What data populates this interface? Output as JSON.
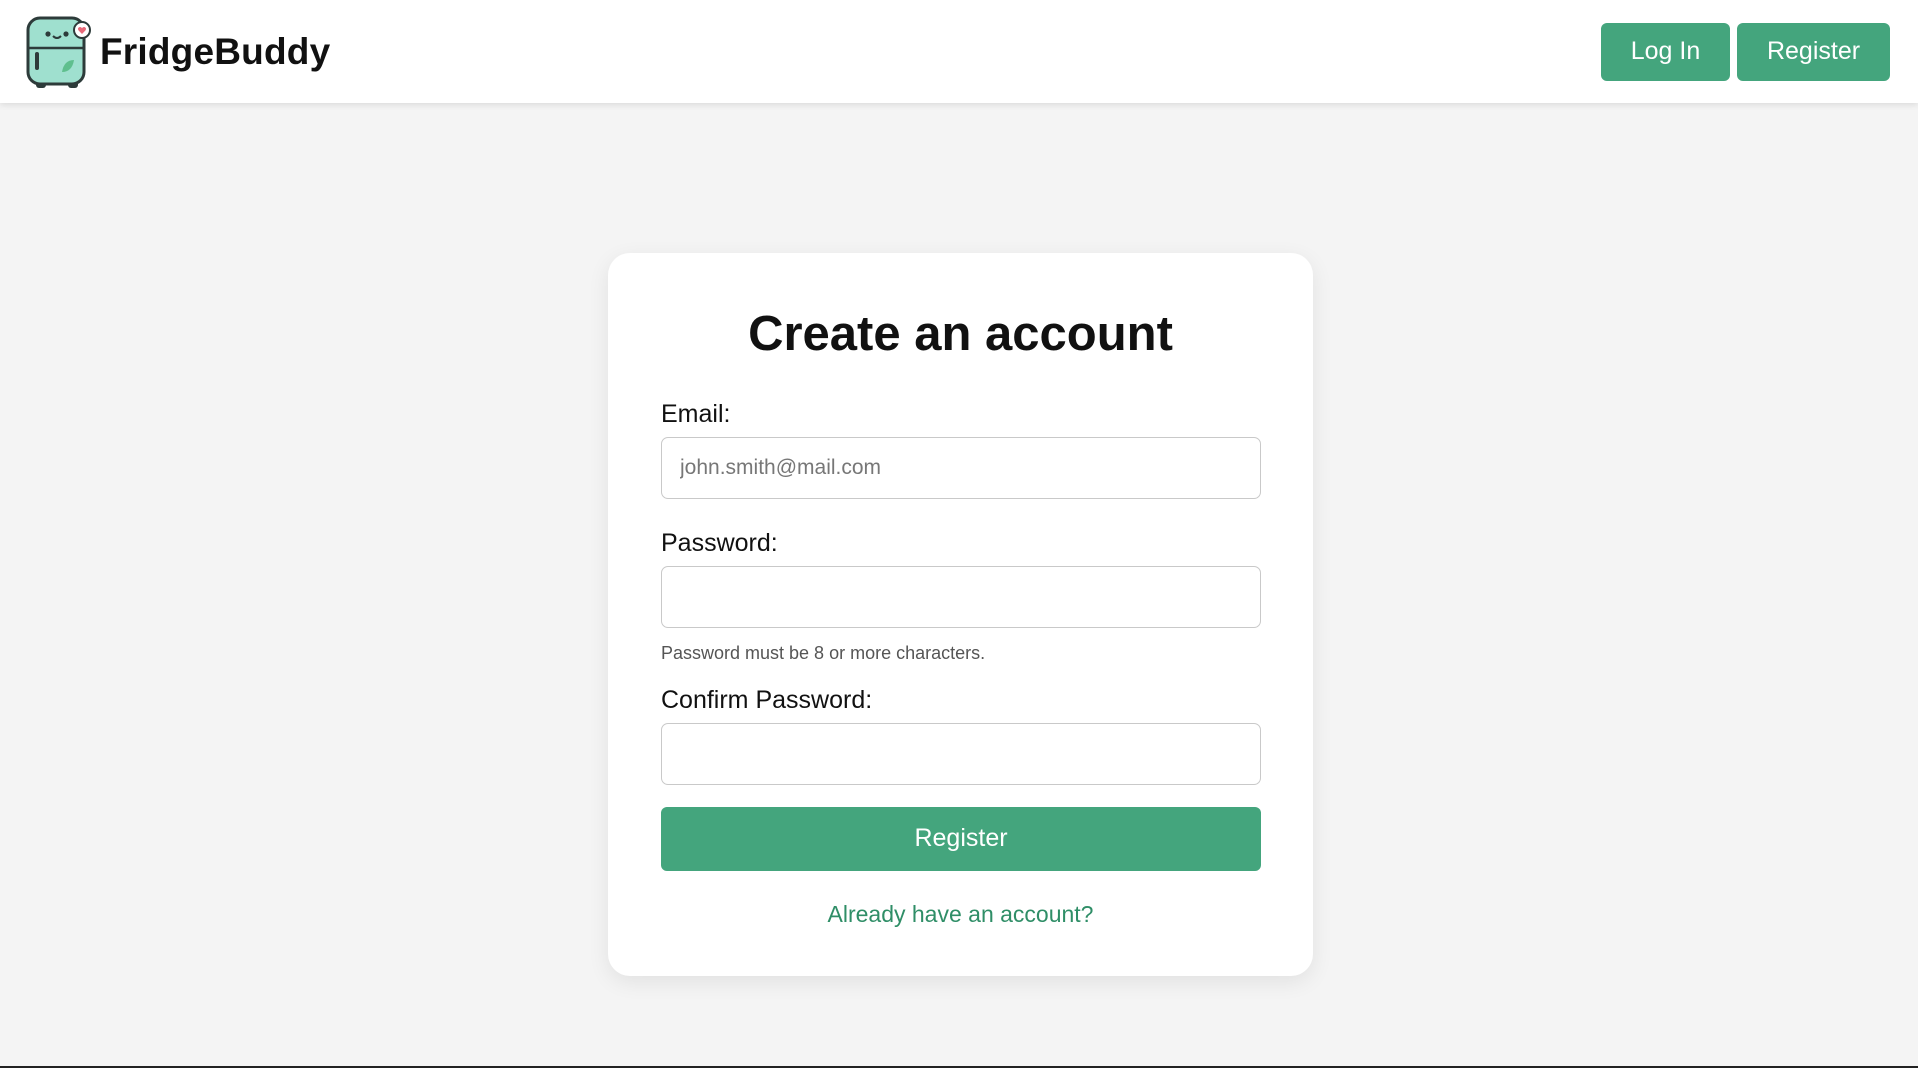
{
  "header": {
    "brand_name": "FridgeBuddy",
    "nav": {
      "login_label": "Log In",
      "register_label": "Register"
    }
  },
  "form": {
    "title": "Create an account",
    "email": {
      "label": "Email:",
      "placeholder": "john.smith@mail.com",
      "value": ""
    },
    "password": {
      "label": "Password:",
      "value": "",
      "hint": "Password must be 8 or more characters."
    },
    "confirm_password": {
      "label": "Confirm Password:",
      "value": ""
    },
    "submit_label": "Register",
    "login_link": "Already have an account?"
  },
  "colors": {
    "accent": "#44a57d",
    "link": "#2f8e67",
    "background": "#f4f4f4",
    "card": "#ffffff",
    "logo_body": "#9fe0cf"
  },
  "icons": {
    "logo": "fridge-mascot-icon"
  }
}
